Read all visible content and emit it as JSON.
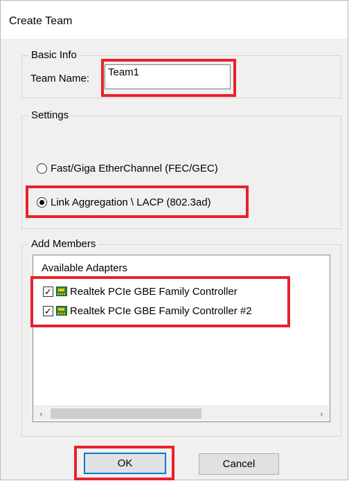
{
  "window": {
    "title": "Create Team"
  },
  "basic_info": {
    "legend": "Basic Info",
    "team_name_label": "Team Name:",
    "team_name_value": "Team1"
  },
  "settings": {
    "legend": "Settings",
    "options": [
      {
        "label": "Fast/Giga EtherChannel (FEC/GEC)",
        "selected": false
      },
      {
        "label": "Link Aggregation \\ LACP (802.3ad)",
        "selected": true
      }
    ]
  },
  "members": {
    "legend": "Add Members",
    "list_header": "Available Adapters",
    "adapters": [
      {
        "label": "Realtek PCIe GBE Family Controller",
        "checked": true
      },
      {
        "label": "Realtek PCIe GBE Family Controller #2",
        "checked": true
      }
    ],
    "scroll_left": "‹",
    "scroll_right": "›"
  },
  "buttons": {
    "ok": "OK",
    "cancel": "Cancel"
  },
  "colors": {
    "highlight": "#e8212c",
    "default_button_border": "#0078d7"
  }
}
